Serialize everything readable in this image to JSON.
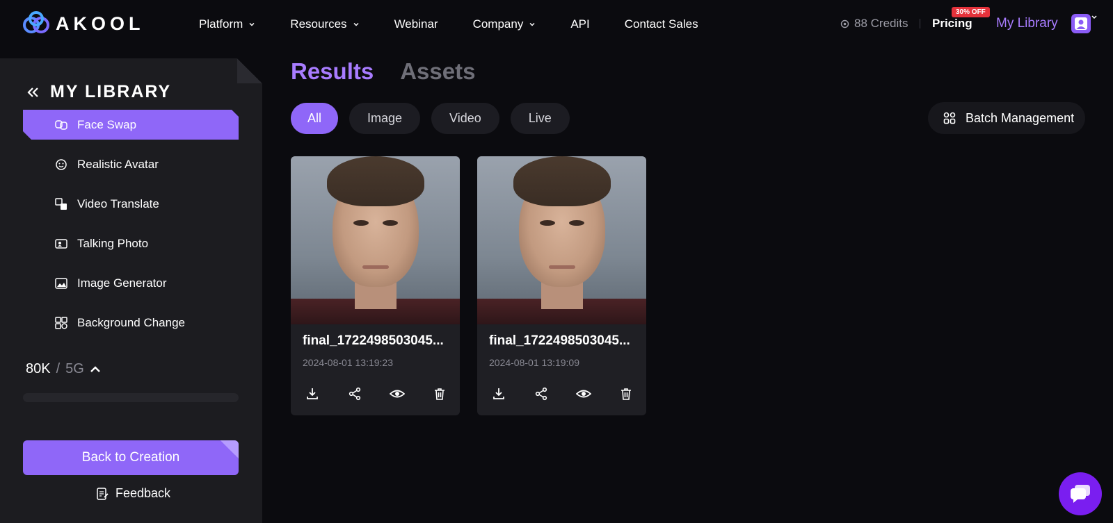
{
  "header": {
    "logo_text": "AKOOL",
    "nav": [
      {
        "label": "Platform",
        "dropdown": true
      },
      {
        "label": "Resources",
        "dropdown": true
      },
      {
        "label": "Webinar",
        "dropdown": false
      },
      {
        "label": "Company",
        "dropdown": true
      },
      {
        "label": "API",
        "dropdown": false
      },
      {
        "label": "Contact Sales",
        "dropdown": false
      }
    ],
    "credits": "88 Credits",
    "pricing": "Pricing",
    "pricing_badge": "30% OFF",
    "my_library": "My Library"
  },
  "sidebar": {
    "title": "MY LIBRARY",
    "items": [
      {
        "label": "Face Swap",
        "icon": "face-swap-icon",
        "active": true
      },
      {
        "label": "Realistic Avatar",
        "icon": "avatar-icon",
        "active": false
      },
      {
        "label": "Video Translate",
        "icon": "translate-icon",
        "active": false
      },
      {
        "label": "Talking Photo",
        "icon": "talking-photo-icon",
        "active": false
      },
      {
        "label": "Image Generator",
        "icon": "image-icon",
        "active": false
      },
      {
        "label": "Background Change",
        "icon": "background-icon",
        "active": false
      }
    ],
    "storage_used": "80K",
    "storage_sep": "/",
    "storage_total": "5G",
    "back_button": "Back to Creation",
    "feedback": "Feedback"
  },
  "main": {
    "tabs": [
      {
        "label": "Results",
        "active": true
      },
      {
        "label": "Assets",
        "active": false
      }
    ],
    "filters": [
      {
        "label": "All",
        "active": true
      },
      {
        "label": "Image",
        "active": false
      },
      {
        "label": "Video",
        "active": false
      },
      {
        "label": "Live",
        "active": false
      }
    ],
    "batch_label": "Batch Management",
    "cards": [
      {
        "name": "final_1722498503045...",
        "date": "2024-08-01 13:19:23"
      },
      {
        "name": "final_1722498503045...",
        "date": "2024-08-01 13:19:09"
      }
    ]
  },
  "colors": {
    "accent": "#8f67f8",
    "accent_text": "#a87cff",
    "background": "#0b0b0f",
    "sidebar": "#1c1c20",
    "badge": "#e5323b",
    "chat": "#7a1ef0"
  }
}
